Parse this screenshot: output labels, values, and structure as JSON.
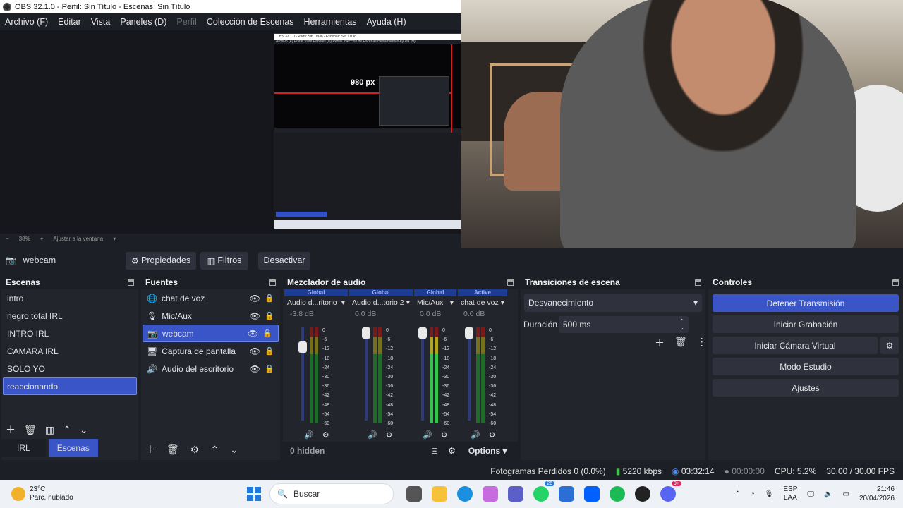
{
  "window": {
    "title": "OBS 32.1.0 - Perfil: Sin Título - Escenas: Sin Título"
  },
  "menu": [
    {
      "label": "Archivo (F)",
      "disabled": false
    },
    {
      "label": "Editar",
      "disabled": false
    },
    {
      "label": "Vista",
      "disabled": false
    },
    {
      "label": "Paneles (D)",
      "disabled": false
    },
    {
      "label": "Perfil",
      "disabled": true
    },
    {
      "label": "Colección de Escenas",
      "disabled": false
    },
    {
      "label": "Herramientas",
      "disabled": false
    },
    {
      "label": "Ayuda (H)",
      "disabled": false
    }
  ],
  "preview": {
    "nested_title": "OBS 32.1.0 - Perfil: Sin Título - Escenas: Sin Título",
    "nested_menu": "Archivo (F)   Editar   Vista   Paneles (D)   Perfil   Colección de Escenas   Herramientas   Ayuda (H)",
    "px_label": "980 px",
    "zoom": {
      "minus": "−",
      "value": "38%",
      "plus": "+",
      "fit": "Ajustar a la ventana"
    }
  },
  "source_toolbar": {
    "source_name": "webcam",
    "properties": "Propiedades",
    "filters": "Filtros",
    "deactivate": "Desactivar"
  },
  "scenes": {
    "title": "Escenas",
    "items": [
      "intro",
      "negro total IRL",
      "INTRO IRL",
      "CAMARA IRL",
      "SOLO YO",
      "reaccionando"
    ],
    "selected": 5,
    "tabs": [
      "IRL",
      "Escenas"
    ]
  },
  "sources": {
    "title": "Fuentes",
    "items": [
      {
        "label": "chat de voz",
        "icon": "globe-icon"
      },
      {
        "label": "Mic/Aux",
        "icon": "microphone-icon"
      },
      {
        "label": "webcam",
        "icon": "camera-icon"
      },
      {
        "label": "Captura de pantalla",
        "icon": "monitor-icon"
      },
      {
        "label": "Audio del escritorio",
        "icon": "speaker-icon"
      }
    ],
    "selected": 2
  },
  "mixer": {
    "title": "Mezclador de audio",
    "channels": [
      {
        "scope": "Global",
        "name": "Audio d...ritorio",
        "db": "-3.8 dB",
        "level": 0.85
      },
      {
        "scope": "Global",
        "name": "Audio d...torio 2",
        "db": "0.0 dB",
        "level": 1.0
      },
      {
        "scope": "Global",
        "name": "Mic/Aux",
        "db": "0.0 dB",
        "level": 1.0
      },
      {
        "scope": "Active",
        "name": "chat de voz",
        "db": "0.0 dB",
        "level": 1.0
      }
    ],
    "scale": [
      "0",
      "-6",
      "-12",
      "-18",
      "-24",
      "-30",
      "-36",
      "-42",
      "-48",
      "-54",
      "-60"
    ],
    "hidden": "0 hidden",
    "options": "Options"
  },
  "transitions": {
    "title": "Transiciones de escena",
    "selected": "Desvanecimiento",
    "duration_label": "Duración",
    "duration_value": "500 ms"
  },
  "controls": {
    "title": "Controles",
    "stream": "Detener Transmisión",
    "record": "Iniciar Grabación",
    "virtual_cam": "Iniciar Cámara Virtual",
    "studio": "Modo Estudio",
    "settings": "Ajustes"
  },
  "status": {
    "dropped": "Fotogramas Perdidos 0 (0.0%)",
    "bitrate": "5220 kbps",
    "stream_time": "03:32:14",
    "rec_time": "00:00:00",
    "cpu": "CPU: 5.2%",
    "fps": "30.00 / 30.00 FPS"
  },
  "taskbar": {
    "temp": "23°C",
    "weather": "Parc. nublado",
    "search": "Buscar",
    "whatsapp_badge": "26",
    "discord_badge": "9+",
    "lang1": "ESP",
    "lang2": "LAA",
    "time": "21:46",
    "date": "20/04/2026"
  },
  "colors": {
    "accent": "#3a55c8",
    "panel": "#23252d",
    "bg": "#1d1f26"
  }
}
